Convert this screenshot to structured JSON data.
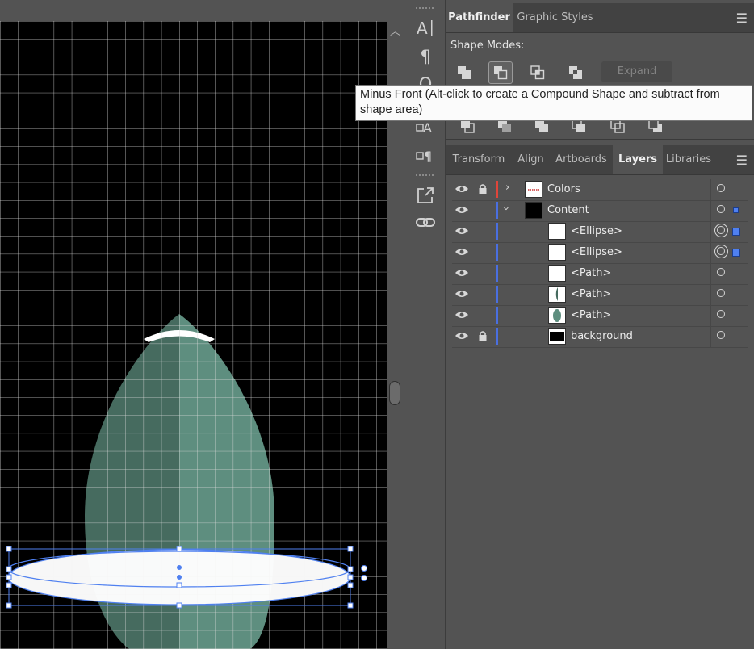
{
  "pathfinder_panel": {
    "tabs": [
      {
        "label": "Pathfinder",
        "active": true
      },
      {
        "label": "Graphic Styles",
        "active": false
      }
    ],
    "shape_modes_label": "Shape Modes:",
    "expand_label": "Expand",
    "tooltip": "Minus Front (Alt-click to create a Compound Shape and subtract from shape area)"
  },
  "layers_panel": {
    "tabs": [
      {
        "label": "Transform",
        "active": false
      },
      {
        "label": "Align",
        "active": false
      },
      {
        "label": "Artboards",
        "active": false
      },
      {
        "label": "Layers",
        "active": true
      },
      {
        "label": "Libraries",
        "active": false
      }
    ],
    "layers": [
      {
        "name": "Colors",
        "locked": true,
        "expanded": false,
        "color": "#e0453a"
      },
      {
        "name": "Content",
        "locked": false,
        "expanded": true,
        "color": "#4a6fe0"
      },
      {
        "name": "<Ellipse>",
        "selected": true
      },
      {
        "name": "<Ellipse>",
        "selected": true
      },
      {
        "name": "<Path>"
      },
      {
        "name": "<Path>"
      },
      {
        "name": "<Path>"
      },
      {
        "name": "background",
        "locked": true
      }
    ]
  },
  "colors": {
    "shape_dark": "#466b5f",
    "shape_light": "#5e8e7f",
    "selection_blue": "#4f80f0",
    "ellipse_fill": "#ffffff"
  }
}
